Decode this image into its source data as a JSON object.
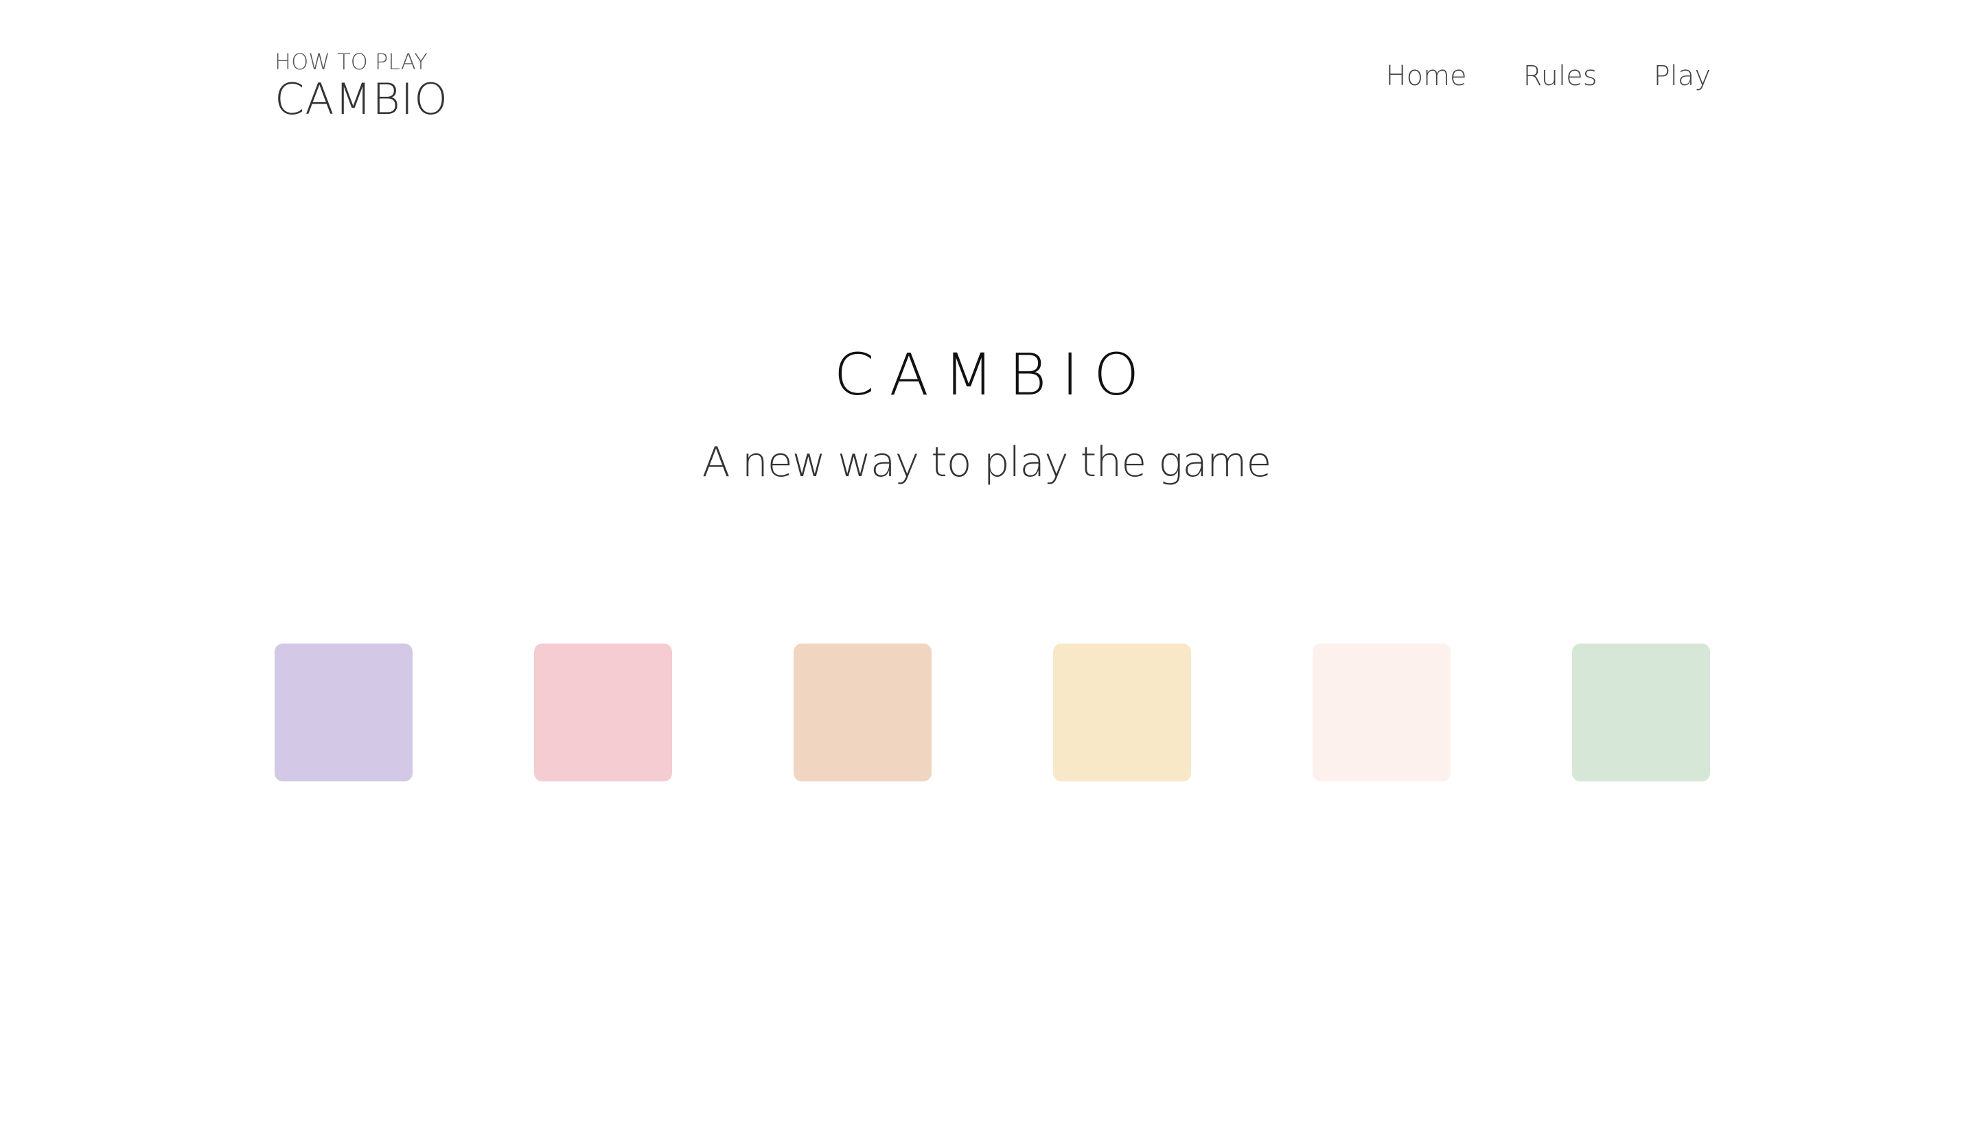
{
  "header": {
    "logo_small": "HOW TO PLAY",
    "logo_large": "CAMBIO",
    "nav": [
      {
        "label": "Home"
      },
      {
        "label": "Rules"
      },
      {
        "label": "Play"
      }
    ]
  },
  "hero": {
    "title": "CAMBIO",
    "subtitle": "A new way to play the game"
  },
  "swatches": [
    {
      "color": "#d3c8e6"
    },
    {
      "color": "#f5ccd1"
    },
    {
      "color": "#f0d5c1"
    },
    {
      "color": "#f8e8c8"
    },
    {
      "color": "#fcf1ec"
    },
    {
      "color": "#d6e6d7"
    }
  ]
}
